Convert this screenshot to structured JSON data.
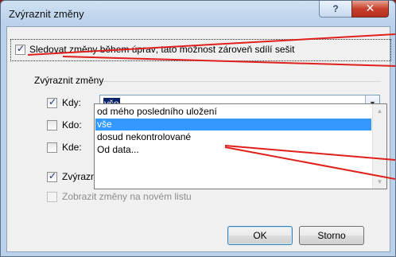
{
  "window": {
    "title": "Zvýraznit změny",
    "help_label": "?",
    "close_label": "✕"
  },
  "track": {
    "label": "Sledovat změny během úprav; tato možnost zároveň sdílí sešit",
    "checked": true
  },
  "group": {
    "label": "Zvýraznit změny"
  },
  "when": {
    "label": "Kdy:",
    "checked": true,
    "value": "vše"
  },
  "who": {
    "label": "Kdo:",
    "checked": false
  },
  "where": {
    "label": "Kde:",
    "checked": false
  },
  "dropdown_options": [
    "od mého posledního uložení",
    "vše",
    "dosud nekontrolované",
    "Od data..."
  ],
  "selected_option": "vše",
  "highlight_on_screen": {
    "label": "Zvýrazni",
    "checked": true
  },
  "new_sheet": {
    "label": "Zobrazit změny na novém listu",
    "checked": false,
    "enabled": false
  },
  "buttons": {
    "ok": "OK",
    "cancel": "Storno"
  },
  "annotation_color": "#e0201b"
}
